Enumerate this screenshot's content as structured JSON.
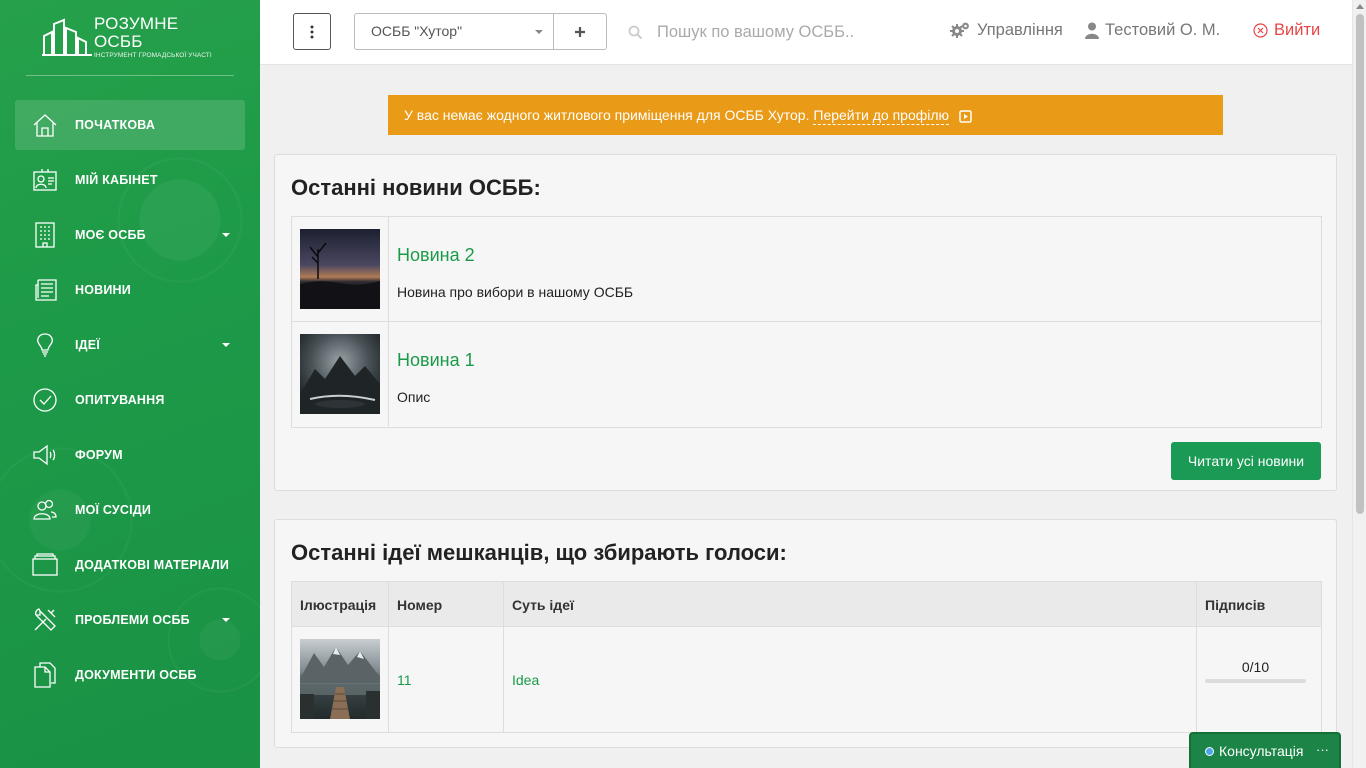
{
  "brand": {
    "title": "РОЗУМНЕ ОСББ",
    "subtitle": "ІНСТРУМЕНТ ГРОМАДСЬКОЇ УЧАСТІ"
  },
  "sidebar": {
    "items": [
      {
        "label": "ПОЧАТКОВА",
        "icon": "home-icon",
        "active": true
      },
      {
        "label": "МІЙ КАБІНЕТ",
        "icon": "id-card-icon"
      },
      {
        "label": "МОЄ ОСББ",
        "icon": "building-icon",
        "dropdown": true
      },
      {
        "label": "НОВИНИ",
        "icon": "newspaper-icon"
      },
      {
        "label": "ІДЕЇ",
        "icon": "lightbulb-icon",
        "dropdown": true
      },
      {
        "label": "ОПИТУВАННЯ",
        "icon": "check-circle-icon"
      },
      {
        "label": "ФОРУМ",
        "icon": "megaphone-icon"
      },
      {
        "label": "МОЇ СУСІДИ",
        "icon": "users-icon"
      },
      {
        "label": "ДОДАТКОВІ МАТЕРІАЛИ",
        "icon": "folder-icon"
      },
      {
        "label": "ПРОБЛЕМИ ОСББ",
        "icon": "tools-icon",
        "dropdown": true
      },
      {
        "label": "ДОКУМЕНТИ ОСББ",
        "icon": "documents-icon"
      }
    ]
  },
  "topbar": {
    "selected_osbb": "ОСББ \"Хутор\"",
    "search_placeholder": "Пошук по вашому ОСББ..",
    "manage_label": "Управління",
    "user_label": "Тестовий О. М.",
    "logout_label": "Вийти"
  },
  "alert": {
    "text": "У вас немає жодного житлового приміщення для ОСББ Хутор.",
    "link_text": "Перейти до профілю"
  },
  "news": {
    "title": "Останні новини ОСББ:",
    "items": [
      {
        "title": "Новина 2",
        "description": "Новина про вибори в нашому ОСББ"
      },
      {
        "title": "Новина 1",
        "description": "Опис"
      }
    ],
    "read_all_label": "Читати усі новини"
  },
  "ideas": {
    "title": "Останні ідеї мешканців, що збирають голоси:",
    "headers": {
      "illustration": "Ілюстрація",
      "number": "Номер",
      "essence": "Суть ідеї",
      "signatures": "Підписів"
    },
    "rows": [
      {
        "number": "11",
        "essence": "Idea",
        "signatures": "0/10",
        "progress": 0
      }
    ]
  },
  "chat": {
    "label": "Консультація",
    "more": "···"
  },
  "colors": {
    "brand_green": "#1a9a49",
    "alert_orange": "#e99a17",
    "logout_red": "#e64545"
  }
}
